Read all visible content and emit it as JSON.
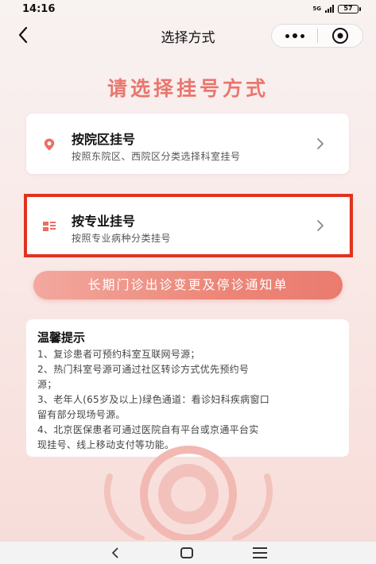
{
  "status_bar": {
    "time": "14:16",
    "network": "5G",
    "battery": "57"
  },
  "nav": {
    "title": "选择方式"
  },
  "heading": "请选择挂号方式",
  "options": [
    {
      "title": "按院区挂号",
      "subtitle": "按照东院区、西院区分类选择科室挂号",
      "icon": "location-pin-icon"
    },
    {
      "title": "按专业挂号",
      "subtitle": "按照专业病种分类挂号",
      "icon": "specialty-list-icon"
    }
  ],
  "notice_button": "长期门诊出诊变更及停诊通知单",
  "tips": {
    "title": "温馨提示",
    "lines": [
      "1、复诊患者可预约科室互联网号源；",
      "2、热门科室号源可通过社区转诊方式优先预约号",
      "源；",
      "3、老年人(65岁及以上)绿色通道：看诊妇科疾病窗口",
      "留有部分现场号源。",
      "4、北京医保患者可通过医院自有平台或京通平台实",
      "现挂号、线上移动支付等功能。"
    ]
  },
  "colors": {
    "accent": "#e9766f",
    "highlight": "#e0331f",
    "button": "#ec8678"
  }
}
